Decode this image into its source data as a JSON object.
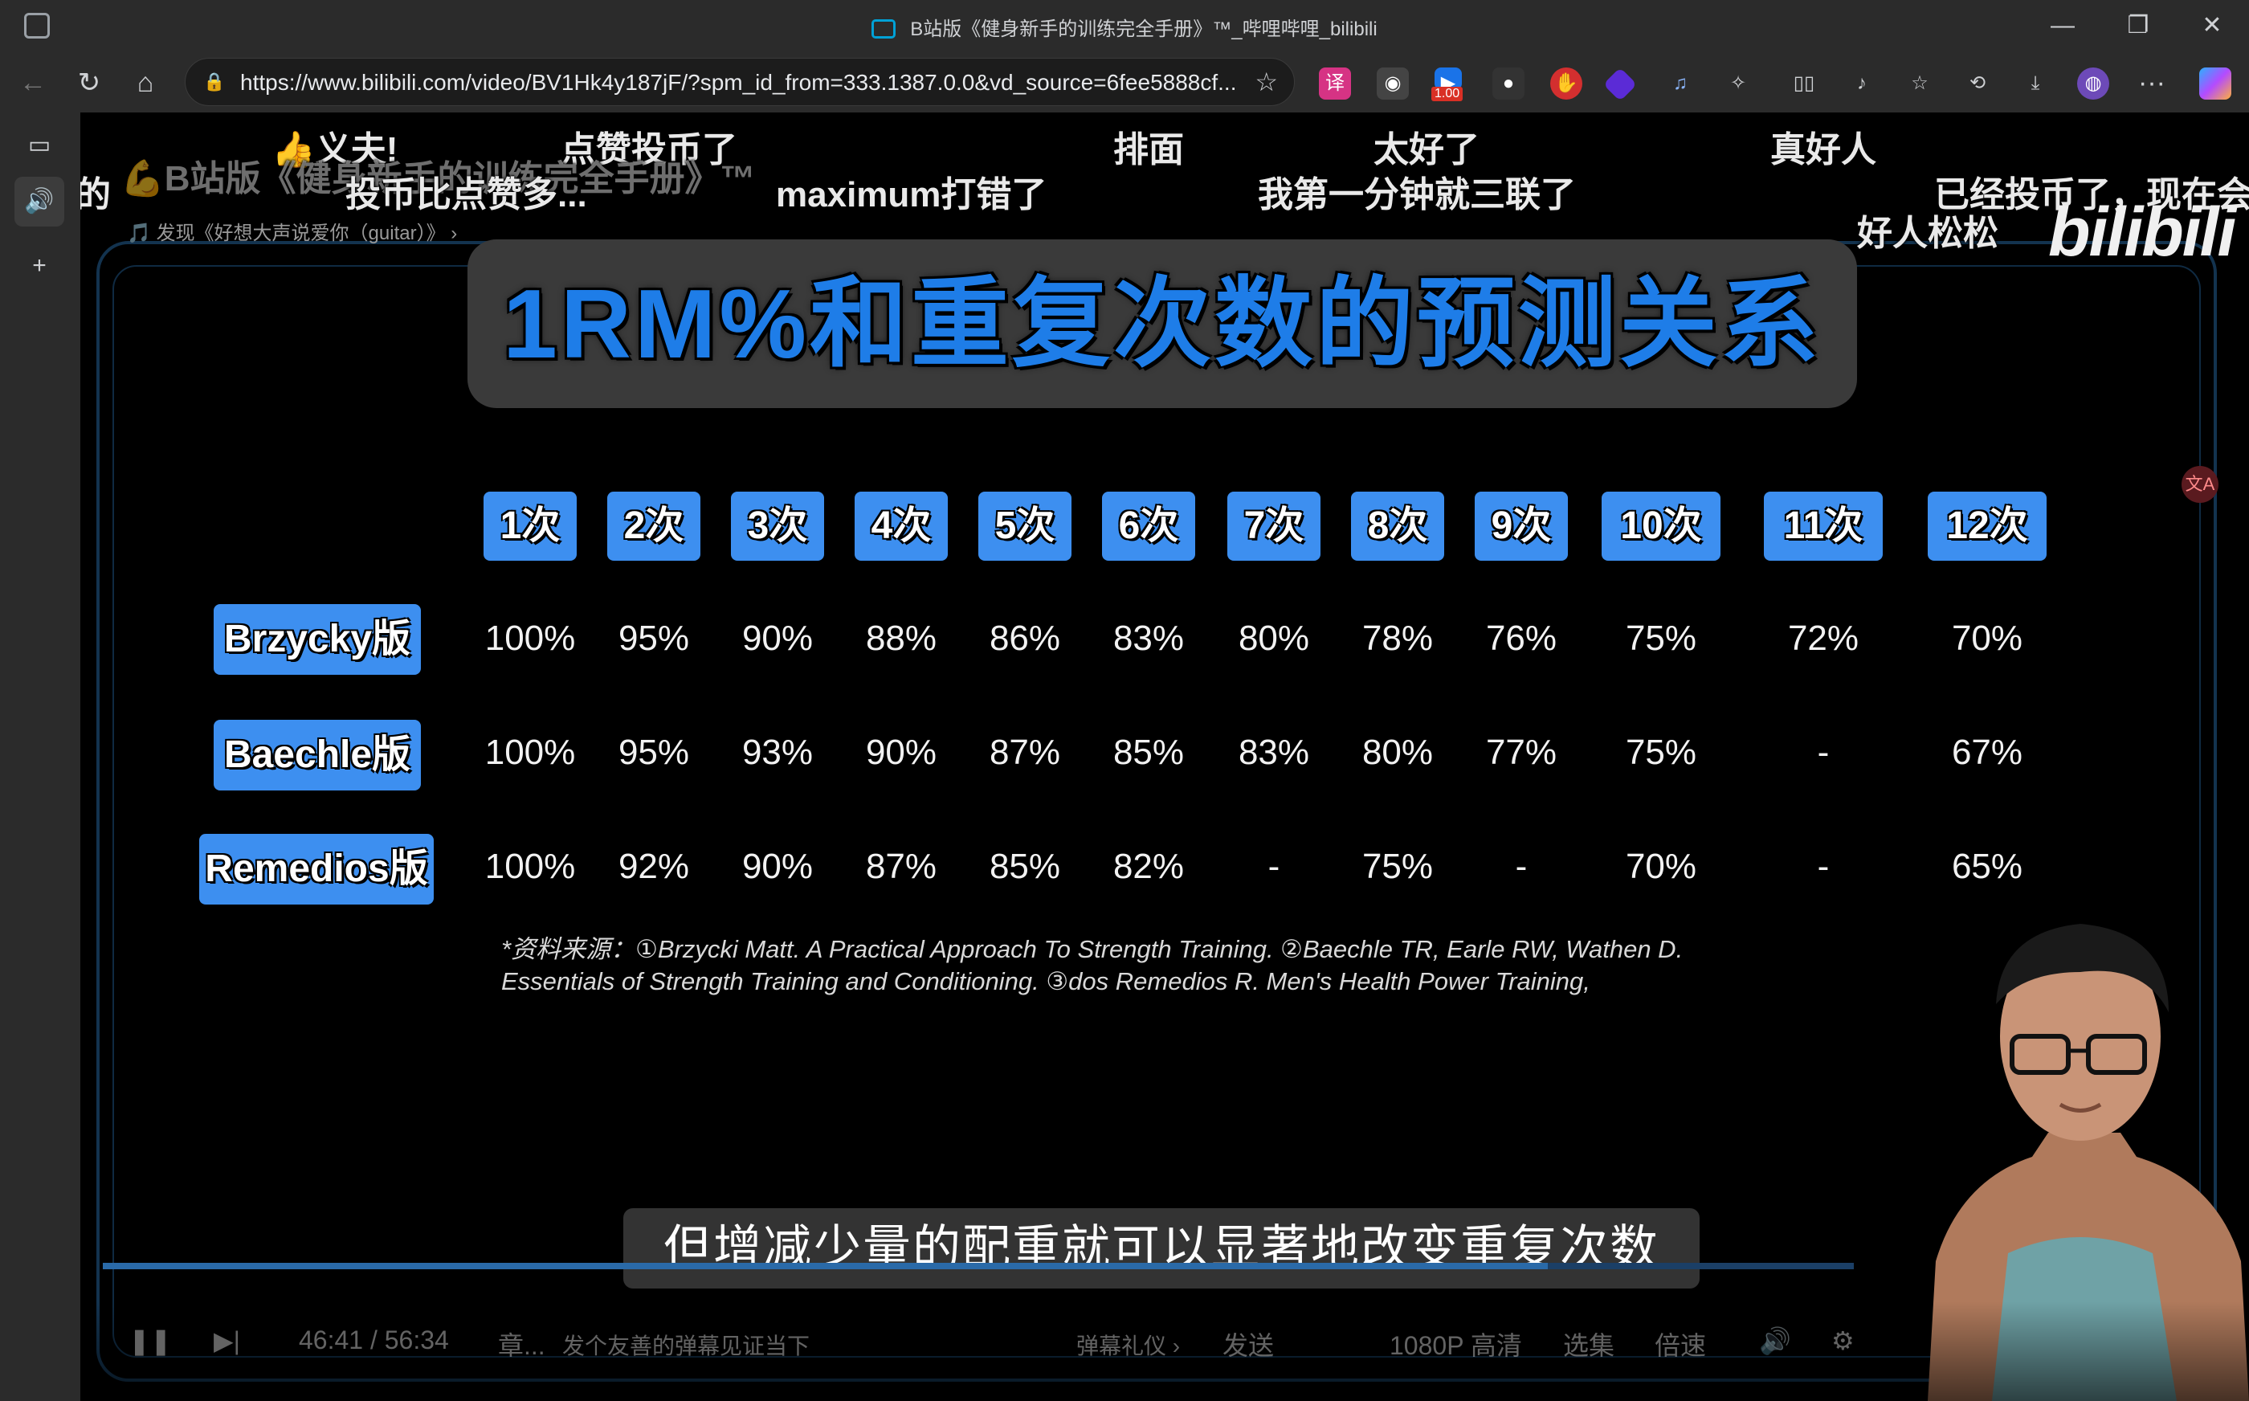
{
  "window": {
    "title": "B站版《健身新手的训练完全手册》™_哔哩哔哩_bilibili",
    "minimize": "—",
    "restore": "❐",
    "close": "✕"
  },
  "toolbar": {
    "back": "←",
    "reload": "↻",
    "home": "⌂",
    "url": "https://www.bilibili.com/video/BV1Hk4y187jF/?spm_id_from=333.1387.0.0&vd_source=6fee5888cf...",
    "zoom_badge": "1.00",
    "menu": "···"
  },
  "danmaku": [
    {
      "text": "👍义夫!",
      "faint": false
    },
    {
      "text": "点赞投币了",
      "faint": false
    },
    {
      "text": "排面",
      "faint": false
    },
    {
      "text": "太好了",
      "faint": false
    },
    {
      "text": "真好人",
      "faint": false
    },
    {
      "text": "投币比点赞多...",
      "faint": false
    },
    {
      "text": "maximum打错了",
      "faint": false
    },
    {
      "text": "我第一分钟就三联了",
      "faint": false
    },
    {
      "text": "已经投币了，现在会",
      "faint": false
    },
    {
      "text": "好人松松",
      "faint": false
    },
    {
      "text": "的",
      "faint": false
    },
    {
      "text": "💪B站版《健身新手的训练完全手册》™",
      "faint": true
    }
  ],
  "music_link": "🎵 发现《好想大声说爱你（guitar）》 ›",
  "watermark": "bilibili",
  "slide": {
    "title": "1RM%和重复次数的预测关系",
    "columns": [
      "1次",
      "2次",
      "3次",
      "4次",
      "5次",
      "6次",
      "7次",
      "8次",
      "9次",
      "10次",
      "11次",
      "12次"
    ],
    "rows": [
      {
        "label": "Brzycky版",
        "values": [
          "100%",
          "95%",
          "90%",
          "88%",
          "86%",
          "83%",
          "80%",
          "78%",
          "76%",
          "75%",
          "72%",
          "70%"
        ]
      },
      {
        "label": "Baechle版",
        "values": [
          "100%",
          "95%",
          "93%",
          "90%",
          "87%",
          "85%",
          "83%",
          "80%",
          "77%",
          "75%",
          "-",
          "67%"
        ]
      },
      {
        "label": "Remedios版",
        "values": [
          "100%",
          "92%",
          "90%",
          "87%",
          "85%",
          "82%",
          "-",
          "75%",
          "-",
          "70%",
          "-",
          "65%"
        ]
      }
    ],
    "source_line1": "*资料来源：①Brzycki Matt. A Practical Approach To Strength Training. ②Baechle TR, Earle RW, Wathen D.",
    "source_line2": "Essentials of Strength Training and Conditioning. ③dos Remedios R. Men's Health Power Training,"
  },
  "subtitle": "但增减少量的配重就可以显著地改变重复次数",
  "player": {
    "time": "46:41 / 56:34",
    "chapter": "章...",
    "danmaku_placeholder": "发个友善的弹幕见证当下",
    "danmaku_etiquette": "弹幕礼仪 ›",
    "send": "发送",
    "quality": "1080P 高清",
    "episodes": "选集",
    "speed": "倍速",
    "progress_fraction": 0.825
  },
  "translate_badge": "文A"
}
